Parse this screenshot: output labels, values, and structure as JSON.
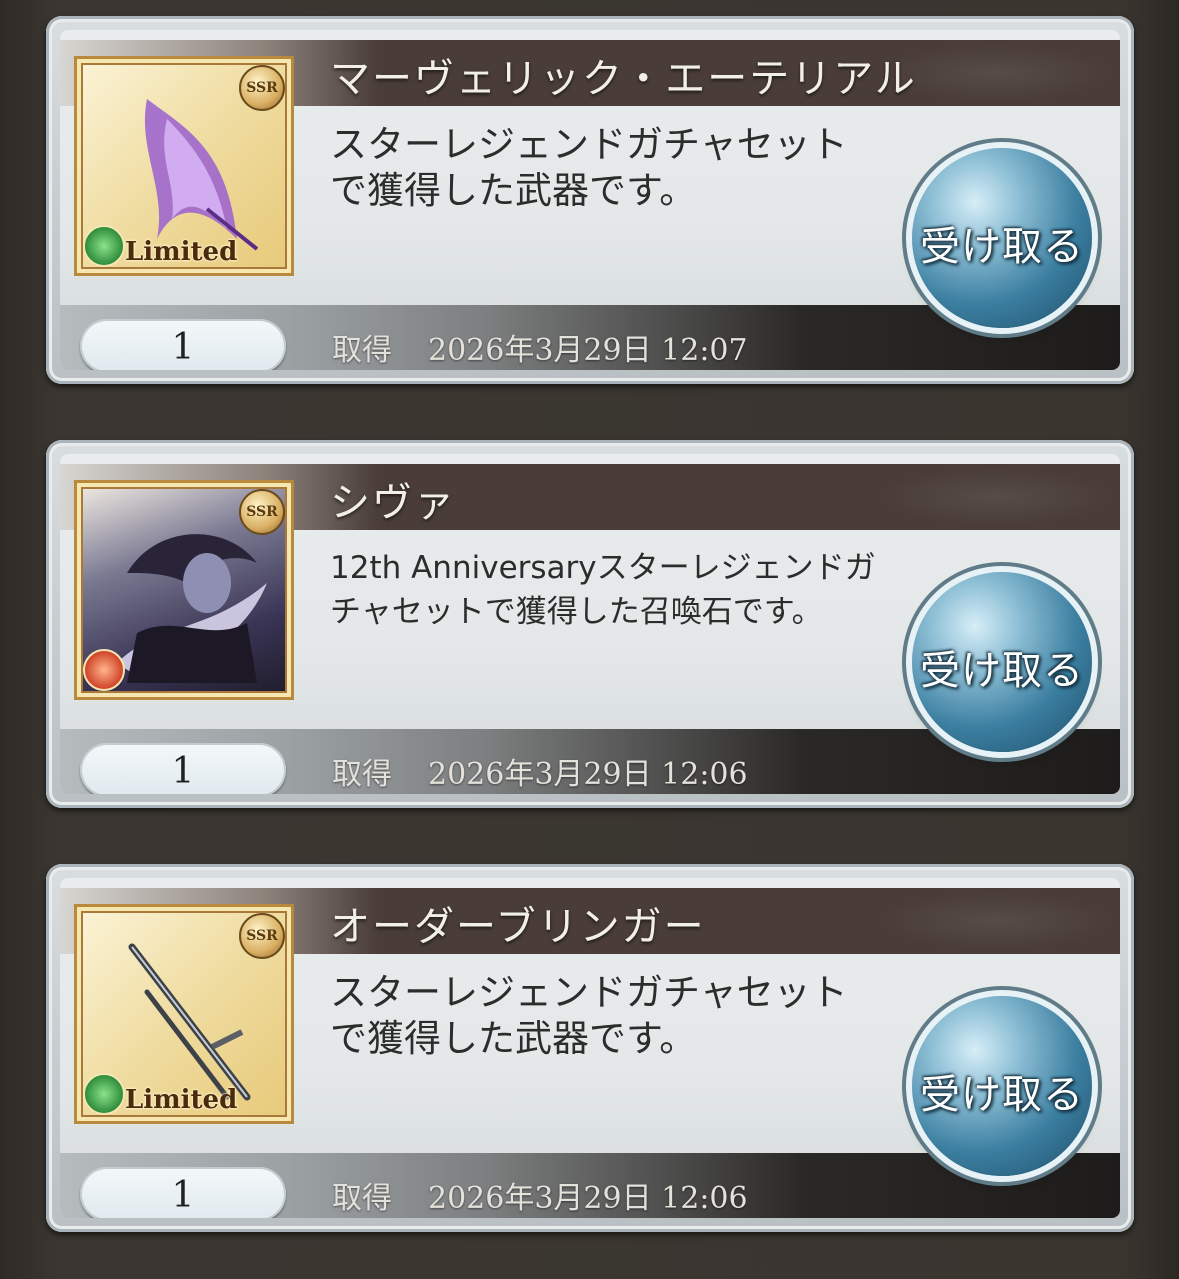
{
  "items": [
    {
      "name": "マーヴェリック・エーテリアル",
      "description": "スターレジェンドガチャセットで獲得した武器です。",
      "rarity": "SSR",
      "element": "wind",
      "limited_label": "Limited",
      "quantity": "1",
      "acquired_label": "取得",
      "acquired_date": "2026年3月29日 12:07",
      "claim_label": "受け取る"
    },
    {
      "name": "シヴァ",
      "description": "12th Anniversaryスターレジェンドガチャセットで獲得した召喚石です。",
      "rarity": "SSR",
      "element": "fire",
      "quantity": "1",
      "acquired_label": "取得",
      "acquired_date": "2026年3月29日 12:06",
      "claim_label": "受け取る"
    },
    {
      "name": "オーダーブリンガー",
      "description": "スターレジェンドガチャセットで獲得した武器です。",
      "rarity": "SSR",
      "element": "wind",
      "limited_label": "Limited",
      "quantity": "1",
      "acquired_label": "取得",
      "acquired_date": "2026年3月29日 12:06",
      "claim_label": "受け取る"
    }
  ]
}
